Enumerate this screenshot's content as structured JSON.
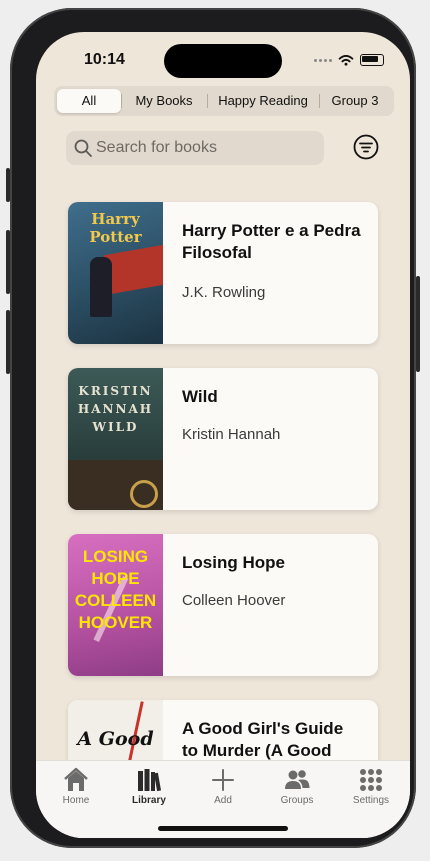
{
  "status": {
    "time": "10:14"
  },
  "segments": [
    {
      "label": "All",
      "active": true
    },
    {
      "label": "My Books",
      "active": false
    },
    {
      "label": "Happy Reading",
      "active": false
    },
    {
      "label": "Group 3",
      "active": false
    }
  ],
  "search": {
    "placeholder": "Search for books"
  },
  "books": [
    {
      "title": "Harry Potter e a Pedra Filosofal",
      "author": "J.K. Rowling",
      "cover_text": "Harry Potter",
      "cover_color": "#2f5e7b"
    },
    {
      "title": "Wild",
      "author": "Kristin Hannah",
      "cover_text": "KRISTIN HANNAH WILD",
      "cover_color": "#2d4a48"
    },
    {
      "title": "Losing Hope",
      "author": "Colleen Hoover",
      "cover_text": "LOSING HOPE COLLEEN HOOVER",
      "cover_color": "#c25aa8"
    },
    {
      "title": "A Good Girl's Guide to Murder (A Good",
      "author": "",
      "cover_text": "A Good",
      "cover_color": "#f2efe9"
    }
  ],
  "tabbar": [
    {
      "label": "Home",
      "icon": "house-icon",
      "active": false
    },
    {
      "label": "Library",
      "icon": "books-icon",
      "active": true
    },
    {
      "label": "Add",
      "icon": "plus-icon",
      "active": false
    },
    {
      "label": "Groups",
      "icon": "people-icon",
      "active": false
    },
    {
      "label": "Settings",
      "icon": "grid-icon",
      "active": false
    }
  ],
  "colors": {
    "background": "#efe6da",
    "card": "#fbfaf7",
    "segment_bg": "#e1d9cd"
  }
}
